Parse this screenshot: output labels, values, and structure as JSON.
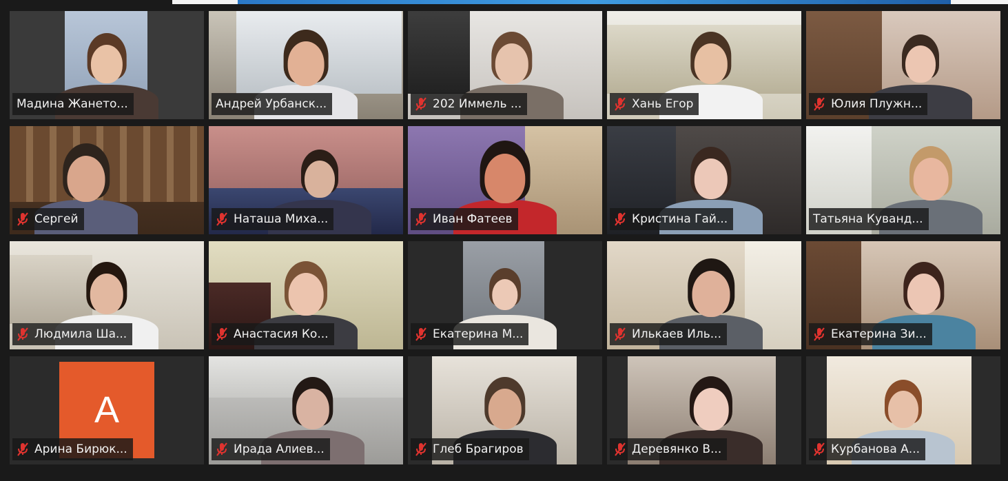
{
  "window": {
    "avatar_letter": "A"
  },
  "participants": [
    {
      "name": "Мадина Жането...",
      "muted": false,
      "speaking": false
    },
    {
      "name": "Андрей Урбанск...",
      "muted": false,
      "speaking": false
    },
    {
      "name": "202 Иммель ...",
      "muted": true,
      "speaking": false
    },
    {
      "name": "Хань Егор",
      "muted": true,
      "speaking": false
    },
    {
      "name": "Юлия Плужн...",
      "muted": true,
      "speaking": false
    },
    {
      "name": "Сергей",
      "muted": true,
      "speaking": false
    },
    {
      "name": "Наташа Миха...",
      "muted": true,
      "speaking": false
    },
    {
      "name": "Иван Фатеев",
      "muted": true,
      "speaking": false
    },
    {
      "name": "Кристина Гай...",
      "muted": true,
      "speaking": false
    },
    {
      "name": "Татьяна Куванд...",
      "muted": false,
      "speaking": true
    },
    {
      "name": "Людмила Ша...",
      "muted": true,
      "speaking": false
    },
    {
      "name": "Анастасия Ко...",
      "muted": true,
      "speaking": false
    },
    {
      "name": "Екатерина М...",
      "muted": true,
      "speaking": false
    },
    {
      "name": "Илькаев Иль...",
      "muted": true,
      "speaking": false
    },
    {
      "name": "Екатерина Зи...",
      "muted": true,
      "speaking": false
    },
    {
      "name": "Арина Бирюк...",
      "muted": true,
      "speaking": false
    },
    {
      "name": "Ирада Алиев...",
      "muted": true,
      "speaking": false
    },
    {
      "name": "Глеб Брагиров",
      "muted": true,
      "speaking": false
    },
    {
      "name": "Деревянко В...",
      "muted": true,
      "speaking": false
    },
    {
      "name": "Курбанова А...",
      "muted": true,
      "speaking": false
    }
  ],
  "colors": {
    "background": "#1a1a1a",
    "tile_background": "#2b2b2b",
    "speaker_outline": "#d6de62",
    "mute_icon": "#e0332f",
    "avatar": "#e45a2b"
  },
  "icons": {
    "muted_microphone": "mic-off-icon"
  }
}
